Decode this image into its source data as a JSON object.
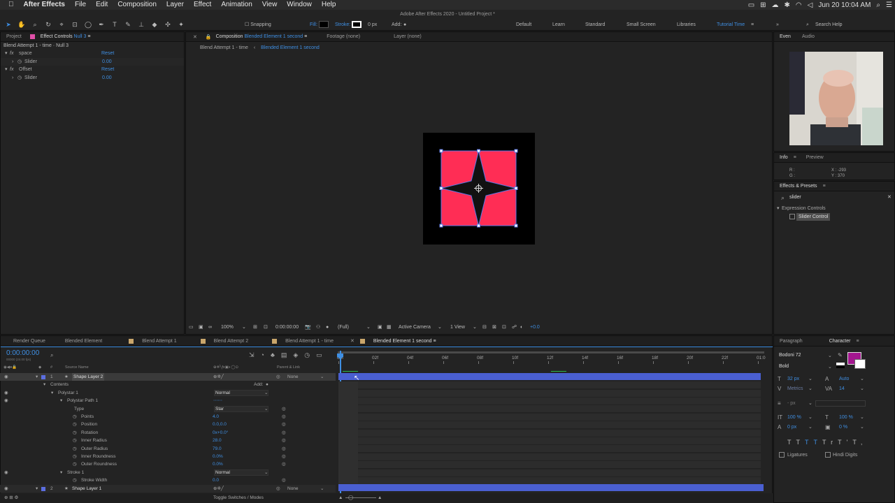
{
  "menubar": {
    "app": "After Effects",
    "items": [
      "File",
      "Edit",
      "Composition",
      "Layer",
      "Effect",
      "Animation",
      "View",
      "Window",
      "Help"
    ],
    "clock": "Jun 20  10:04 AM"
  },
  "window_title": "Adobe After Effects 2020 - Untitled Project *",
  "toolbar": {
    "snapping": "Snapping",
    "fill": "Fill:",
    "stroke": "Stroke:",
    "stroke_px": "0 px",
    "add": "Add:",
    "workspaces": [
      "Default",
      "Learn",
      "Standard",
      "Small Screen",
      "Libraries",
      "Tutorial Time"
    ],
    "search_help": "Search Help"
  },
  "project_panel": {
    "tab_project": "Project",
    "tab_effect_controls": "Effect Controls",
    "effect_controls_target": "Null 3",
    "header": "Blend Attempt 1 - time · Null 3",
    "effects": [
      {
        "fx": "fx",
        "name": "space",
        "reset": "Reset",
        "child": "Slider",
        "value": "0.00"
      },
      {
        "fx": "fx",
        "name": "Offset",
        "reset": "Reset",
        "child": "Slider",
        "value": "0.00"
      }
    ]
  },
  "comp_panel": {
    "tab_comp_label": "Composition",
    "tab_comp_name": "Blended Element 1 second",
    "tab_footage": "Footage (none)",
    "tab_layer": "Layer (none)",
    "breadcrumb_1": "Blend Attempt 1 - time",
    "breadcrumb_2": "Blended Element 1 second",
    "footer": {
      "zoom": "100%",
      "timecode": "0:00:00:00",
      "resolution": "(Full)",
      "camera": "Active Camera",
      "view": "1 View",
      "exposure": "+0.0"
    }
  },
  "right_panels": {
    "tab_even": "Even",
    "tab_audio": "Audio",
    "tab_info": "Info",
    "tab_preview": "Preview",
    "info_r": "R :",
    "info_g": "G :",
    "info_x": "X : -293",
    "info_y": "Y : 370",
    "effects_presets": "Effects & Presets",
    "search_value": "slider",
    "category": "Expression Controls",
    "result": "Slider Control"
  },
  "timeline": {
    "tabs": [
      "Render Queue",
      "Blended Element",
      "Blend Attempt 1",
      "Blend Attempt 2",
      "Blend Attempt 1 - time",
      "Blended Element 1 second"
    ],
    "timecode": "0:00:00:00",
    "subtimecode": "00000 (24.00 fps)",
    "col_source": "Source Name",
    "col_parent": "Parent & Link",
    "ruler": [
      "00f",
      "02f",
      "04f",
      "06f",
      "08f",
      "10f",
      "12f",
      "14f",
      "16f",
      "18f",
      "20f",
      "22f",
      "01:0"
    ],
    "layers_label": "Toggle Switches / Modes",
    "rows": [
      {
        "num": "1",
        "name": "Shape Layer 2",
        "parent": "None",
        "kind": "layer"
      },
      {
        "name": "Contents",
        "add": "Add:",
        "kind": "group1"
      },
      {
        "name": "Polystar 1",
        "mode": "Normal",
        "kind": "group2"
      },
      {
        "name": "Polystar Path 1",
        "kind": "group3"
      },
      {
        "name": "Type",
        "value": "Star",
        "kind": "prop"
      },
      {
        "name": "Points",
        "value": "4.0",
        "kind": "prop"
      },
      {
        "name": "Position",
        "value": "0.0,0.0",
        "kind": "prop"
      },
      {
        "name": "Rotation",
        "value": "0x+0.0°",
        "kind": "prop"
      },
      {
        "name": "Inner Radius",
        "value": "28.0",
        "kind": "prop"
      },
      {
        "name": "Outer Radius",
        "value": "79.0",
        "kind": "prop"
      },
      {
        "name": "Inner Roundness",
        "value": "0.0%",
        "kind": "prop"
      },
      {
        "name": "Outer Roundness",
        "value": "0.0%",
        "kind": "prop"
      },
      {
        "name": "Stroke 1",
        "mode": "Normal",
        "kind": "group3b"
      },
      {
        "name": "Stroke Width",
        "value": "0.0",
        "kind": "prop"
      },
      {
        "num": "2",
        "name": "Shape Layer 1",
        "parent": "None",
        "kind": "layer"
      }
    ]
  },
  "char_panel": {
    "tab_paragraph": "Paragraph",
    "tab_character": "Character",
    "font": "Bodoni 72",
    "style": "Bold",
    "size": "32 px",
    "leading": "Auto",
    "kerning": "Metrics",
    "tracking": "14",
    "stroke_width": "- px",
    "vscale": "100 %",
    "hscale": "100 %",
    "baseline": "0 px",
    "tsume": "0 %",
    "ligatures": "Ligatures",
    "hindi": "Hindi Digits"
  },
  "colors": {
    "accent": "#3f8fe3",
    "shape_fill": "#ff2d55",
    "layer_bar": "#4a5fd1",
    "char_fill": "#a3168f"
  }
}
